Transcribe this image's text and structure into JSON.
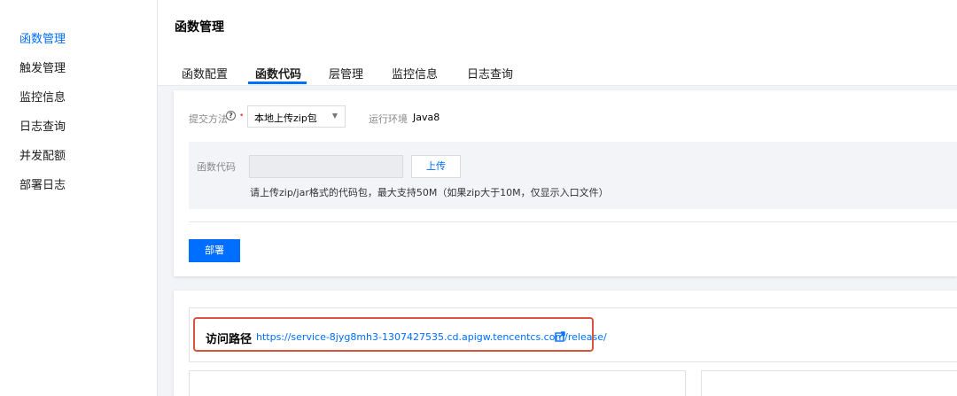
{
  "sidebar": {
    "items": [
      {
        "label": "函数管理",
        "active": true
      },
      {
        "label": "触发管理"
      },
      {
        "label": "监控信息"
      },
      {
        "label": "日志查询"
      },
      {
        "label": "并发配额"
      },
      {
        "label": "部署日志"
      }
    ]
  },
  "header": {
    "title": "函数管理",
    "tabs": [
      "函数配置",
      "函数代码",
      "层管理",
      "监控信息",
      "日志查询"
    ],
    "active_tab": "函数代码"
  },
  "code_form": {
    "submit_method_label": "提交方法",
    "submit_method_value": "本地上传zip包",
    "runtime_label": "运行环境",
    "runtime_value": "Java8",
    "code_label": "函数代码",
    "upload_button": "上传",
    "hint": "请上传zip/jar格式的代码包，最大支持50M（如果zip大于10M，仅显示入口文件）",
    "deploy_button": "部署"
  },
  "access": {
    "label": "访问路径",
    "url": "https://service-8jyg8mh3-1307427535.cd.apigw.tencentcs.com/release/"
  },
  "colors": {
    "accent": "#006eff",
    "highlight_border": "#d9533f",
    "required": "#e54545"
  }
}
